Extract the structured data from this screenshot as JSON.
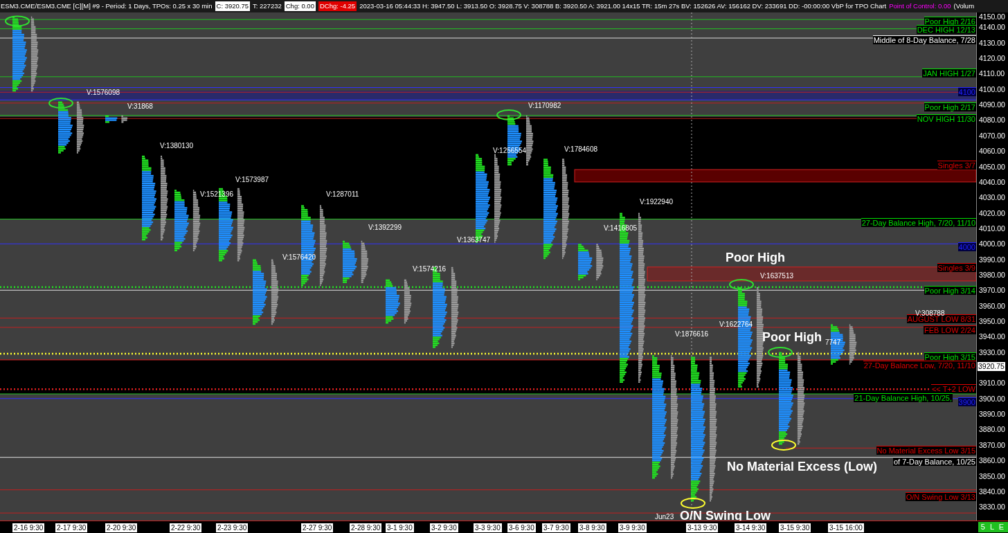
{
  "header": {
    "segments": [
      {
        "text": "ESM3.CME/ESM3.CME [C][M]  #9 - Period: 1 Days, TPOs: 0.25 x 30 min",
        "kind": "plain"
      },
      {
        "text": "C: 3920.75",
        "kind": "value"
      },
      {
        "text": "T: 227232",
        "kind": "plain"
      },
      {
        "text": "Chg: 0.00",
        "kind": "value"
      },
      {
        "text": "DChg: -4.25",
        "kind": "alert"
      },
      {
        "text": "2023-03-16 05:44:33 H: 3947.50 L: 3913.50 O: 3928.75 V: 308788 B: 3920.50 A: 3921.00 14x15 TR: 15m 27s BV: 152626 AV: 156162 DV: 233691 DD: -00:00:00 VbP for TPO Chart",
        "kind": "plain"
      },
      {
        "text": "Point of Control: 0.00",
        "kind": "accent"
      },
      {
        "text": "(Volum",
        "kind": "plain"
      }
    ]
  },
  "chart": {
    "price_labels": [
      "4150.00",
      "4140.00",
      "4130.00",
      "4120.00",
      "4110.00",
      "4100.00",
      "4090.00",
      "4080.00",
      "4070.00",
      "4060.00",
      "4050.00",
      "4040.00",
      "4030.00",
      "4020.00",
      "4010.00",
      "4000.00",
      "3990.00",
      "3980.00",
      "3970.00",
      "3960.00",
      "3950.00",
      "3940.00",
      "3930.00",
      "3910.00",
      "3900.00",
      "3890.00",
      "3880.00",
      "3870.00",
      "3860.00",
      "3850.00",
      "3840.00",
      "3830.00"
    ],
    "current_price": "3920.75",
    "level_labels": [
      {
        "text": "Poor High 2/16",
        "color": "#00e000",
        "kind": "text"
      },
      {
        "text": "DEC HIGH 12/13",
        "color": "#00e000",
        "kind": "text"
      },
      {
        "text": "Middle of 8-Day Balance, 7/28",
        "color": "#ffffff",
        "kind": "text"
      },
      {
        "text": "JAN HIGH 1/27",
        "color": "#00e000",
        "kind": "text"
      },
      {
        "text": "4100",
        "color": "#2020ff",
        "kind": "tag"
      },
      {
        "text": "Poor High 2/17",
        "color": "#00e000",
        "kind": "text"
      },
      {
        "text": "NOV HIGH 11/30",
        "color": "#00e000",
        "kind": "text"
      },
      {
        "text": "Singles 3/7",
        "color": "#e00000",
        "kind": "text"
      },
      {
        "text": "27-Day Balance High, 7/20, 11/10",
        "color": "#00e000",
        "kind": "text"
      },
      {
        "text": "4000",
        "color": "#2020ff",
        "kind": "tag"
      },
      {
        "text": "Singles 3/9",
        "color": "#e00000",
        "kind": "text"
      },
      {
        "text": "Poor High 3/14",
        "color": "#00e000",
        "kind": "text"
      },
      {
        "text": "AUGUST LOW 8/31",
        "color": "#e00000",
        "kind": "text"
      },
      {
        "text": "FEB LOW 2/24",
        "color": "#e00000",
        "kind": "text"
      },
      {
        "text": "Poor High 3/15",
        "color": "#00e000",
        "kind": "text"
      },
      {
        "text": "27-Day Balance Low, 7/20, 11/10",
        "color": "#e00000",
        "kind": "text"
      },
      {
        "text": "<< T+2 LOW",
        "color": "#e00000",
        "kind": "text"
      },
      {
        "text": "21-Day Balance High, 10/25,",
        "color": "#00e000",
        "kind": "text"
      },
      {
        "text": "3900",
        "color": "#2020ff",
        "kind": "tag"
      },
      {
        "text": "No Material Excess Low 3/15",
        "color": "#e00000",
        "kind": "text"
      },
      {
        "text": "of 7-Day Balance, 10/25",
        "color": "#ffffff",
        "kind": "text"
      },
      {
        "text": "O/N Swing Low 3/13",
        "color": "#e00000",
        "kind": "text"
      }
    ],
    "volume_labels": [
      "V:1576098",
      "V:31868",
      "V:1380130",
      "V:1573987",
      "V:1521396",
      "V:1287011",
      "V:1392299",
      "V:1576420",
      "V:1574216",
      "V:1363747",
      "V:1256554",
      "V:1170982",
      "V:1784608",
      "V:1922940",
      "V:1416805",
      "V:1637513",
      "V:1876616",
      "V:1622764",
      "V:308788",
      "7747"
    ],
    "annotations": [
      "Poor High",
      "Poor High",
      "No Material Excess (Low)",
      "O/N Swing Low"
    ],
    "contract_label": "Jun23",
    "date_labels": [
      "2-16 9:30",
      "2-17 9:30",
      "2-20 9:30",
      "2-22 9:30",
      "2-23 9:30",
      "2-27 9:30",
      "2-28 9:30",
      "3-1 9:30",
      "3-2 9:30",
      "3-3 9:30",
      "3-6 9:30",
      "3-7 9:30",
      "3-8 9:30",
      "3-9 9:30",
      "3-13 9:30",
      "3-14 9:30",
      "3-15 9:30",
      "3-15 16:00"
    ],
    "status": "5 L E"
  }
}
